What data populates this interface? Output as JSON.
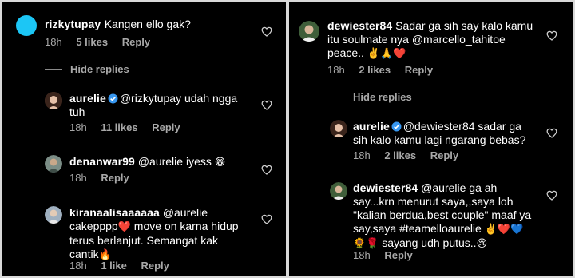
{
  "left": {
    "c1": {
      "user": "rizkytupay",
      "text": "Kangen ello gak?",
      "time": "18h",
      "likes": "5 likes",
      "reply": "Reply"
    },
    "hide_replies": "Hide replies",
    "c2": {
      "user": "aurelie",
      "mention": "@rizkytupay",
      "text_a": " udah ngga",
      "text_b": "tuh",
      "time": "18h",
      "likes": "11 likes",
      "reply": "Reply"
    },
    "c3": {
      "user": "denanwar99",
      "text": "@aurelie iyess",
      "emoji": "😁",
      "time": "18h",
      "reply": "Reply"
    },
    "c4": {
      "user": "kiranaalisaaaaaa",
      "line1": "@aurelie",
      "line2": "cakepppp",
      "emoji1": "❤️",
      "line2b": " move on karna hidup",
      "line3": "terus berlanjut. Semangat kak",
      "line4": "cantik",
      "emoji2": "🔥",
      "time": "18h",
      "likes": "1 like",
      "reply": "Reply"
    }
  },
  "right": {
    "c1": {
      "user": "dewiester84",
      "line1": "Sadar ga sih say kalo kamu",
      "line2": "itu soulmate nya @marcello_tahitoe",
      "line3": "peace..",
      "emoji": "✌️🙏❤️",
      "time": "18h",
      "likes": "2 likes",
      "reply": "Reply"
    },
    "hide_replies": "Hide replies",
    "c2": {
      "user": "aurelie",
      "line1": "@dewiester84 sadar ga",
      "line2": "sih kalo kamu lagi ngarang bebas?",
      "time": "18h",
      "likes": "2 likes",
      "reply": "Reply"
    },
    "c3": {
      "user": "dewiester84",
      "line1": "@aurelie ga ah",
      "line2": "say...krn menurut saya,,saya loh",
      "line3": "\"kalian berdua,best couple\" maaf ya",
      "line4": "say,saya #teamelloaurelie",
      "emoji4": "✌️❤️💙",
      "line5a": "🌻🌹",
      "line5b": " sayang udh putus..",
      "emoji5": "😢",
      "time": "18h",
      "reply": "Reply"
    }
  },
  "colors": {
    "verified": "#3897f0",
    "meta": "#a8a8a8",
    "avatar_rizky": "#1cc6f5"
  }
}
